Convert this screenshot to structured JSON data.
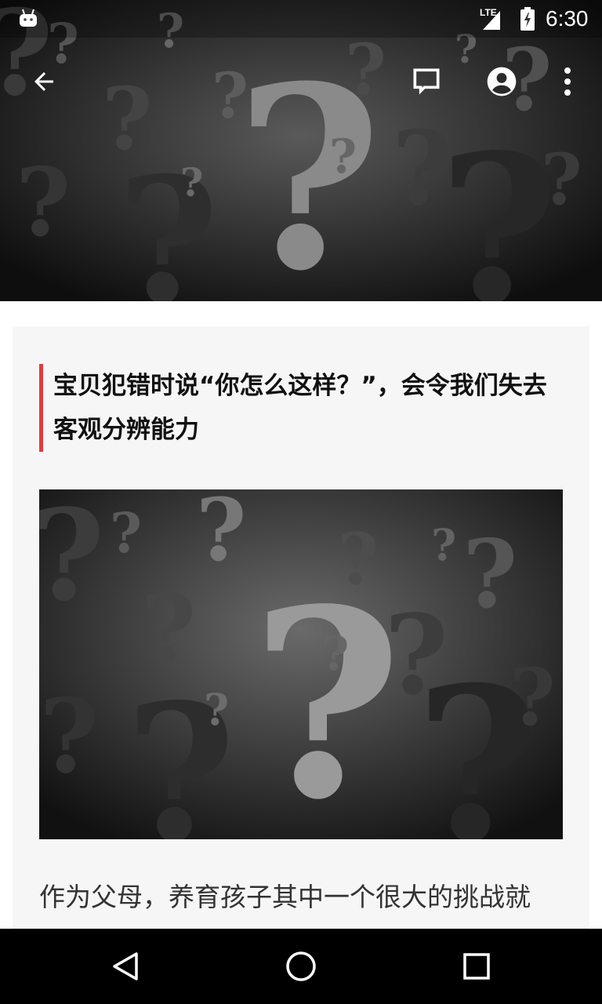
{
  "status_bar": {
    "network_label": "LTE",
    "time": "6:30",
    "icons": [
      "android-debug-icon",
      "signal-icon",
      "battery-charging-icon"
    ]
  },
  "toolbar": {
    "icons": [
      "back-arrow-icon",
      "comment-icon",
      "account-circle-icon",
      "more-vert-icon"
    ]
  },
  "article": {
    "title": "宝贝犯错时说“你怎么这样？”，会令我们失去客观分辨能力",
    "body_first_line": "作为父母，养育孩子其中一个很大的挑战就",
    "accent_color": "#e03c3c"
  },
  "nav_bar": {
    "icons": [
      "nav-back-icon",
      "nav-home-icon",
      "nav-recents-icon"
    ]
  }
}
